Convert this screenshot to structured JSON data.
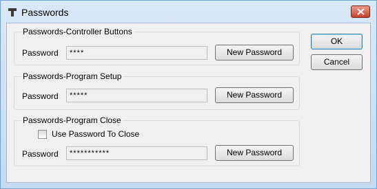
{
  "window": {
    "title": "Passwords",
    "title_icon": "key-icon",
    "close_icon": "close-icon"
  },
  "groups": [
    {
      "legend": "Passwords-Controller Buttons",
      "password_label": "Password",
      "password_value": "****",
      "button_label": "New Password"
    },
    {
      "legend": "Passwords-Program Setup",
      "password_label": "Password",
      "password_value": "*****",
      "button_label": "New Password"
    },
    {
      "legend": "Passwords-Program Close",
      "checkbox_label": "Use Password To Close",
      "checkbox_checked": false,
      "password_label": "Password",
      "password_value": "***********",
      "button_label": "New Password"
    }
  ],
  "buttons": {
    "ok": "OK",
    "cancel": "Cancel"
  },
  "colors": {
    "title_gradient": "#d9e8f7",
    "close_button": "#c2452b",
    "client_background": "#f0f0f0"
  }
}
